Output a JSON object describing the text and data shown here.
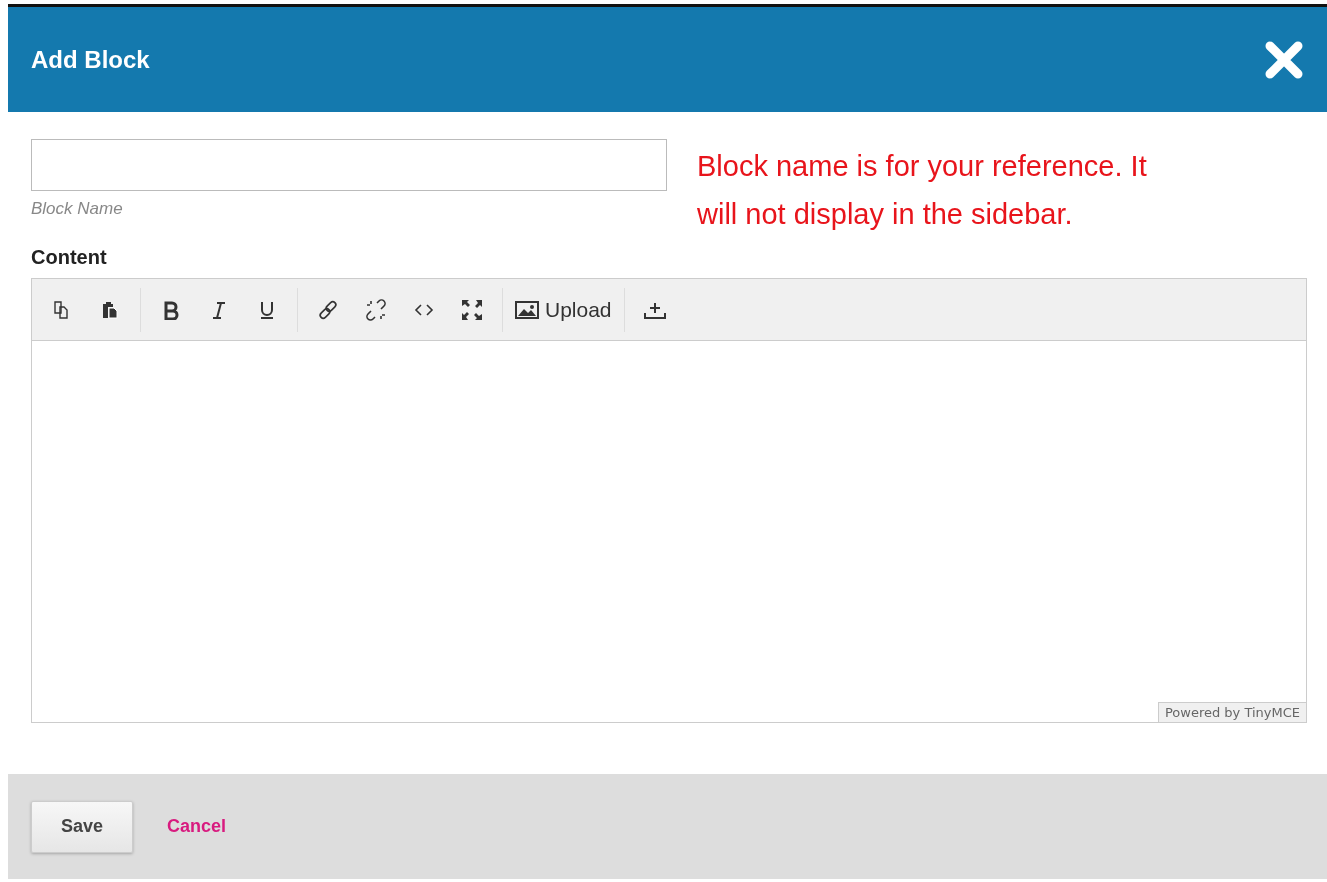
{
  "dialog": {
    "title": "Add Block"
  },
  "name_field": {
    "helper": "Block Name"
  },
  "note": "Block name is for your reference. It will not display in the sidebar.",
  "content": {
    "label": "Content",
    "toolbar": [
      [
        {
          "kind": "copy"
        },
        {
          "kind": "paste"
        }
      ],
      [
        {
          "kind": "bold"
        },
        {
          "kind": "italic"
        },
        {
          "kind": "underline"
        }
      ],
      [
        {
          "kind": "link"
        },
        {
          "kind": "unlink"
        },
        {
          "kind": "code"
        },
        {
          "kind": "fullscreen"
        }
      ],
      [
        {
          "kind": "image",
          "label": "Upload"
        }
      ],
      [
        {
          "kind": "insert"
        }
      ]
    ],
    "branding": "Powered by TinyMCE"
  },
  "buttons": [
    {
      "kind": "primary",
      "label": "Save"
    },
    {
      "kind": "link",
      "label": "Cancel"
    }
  ]
}
